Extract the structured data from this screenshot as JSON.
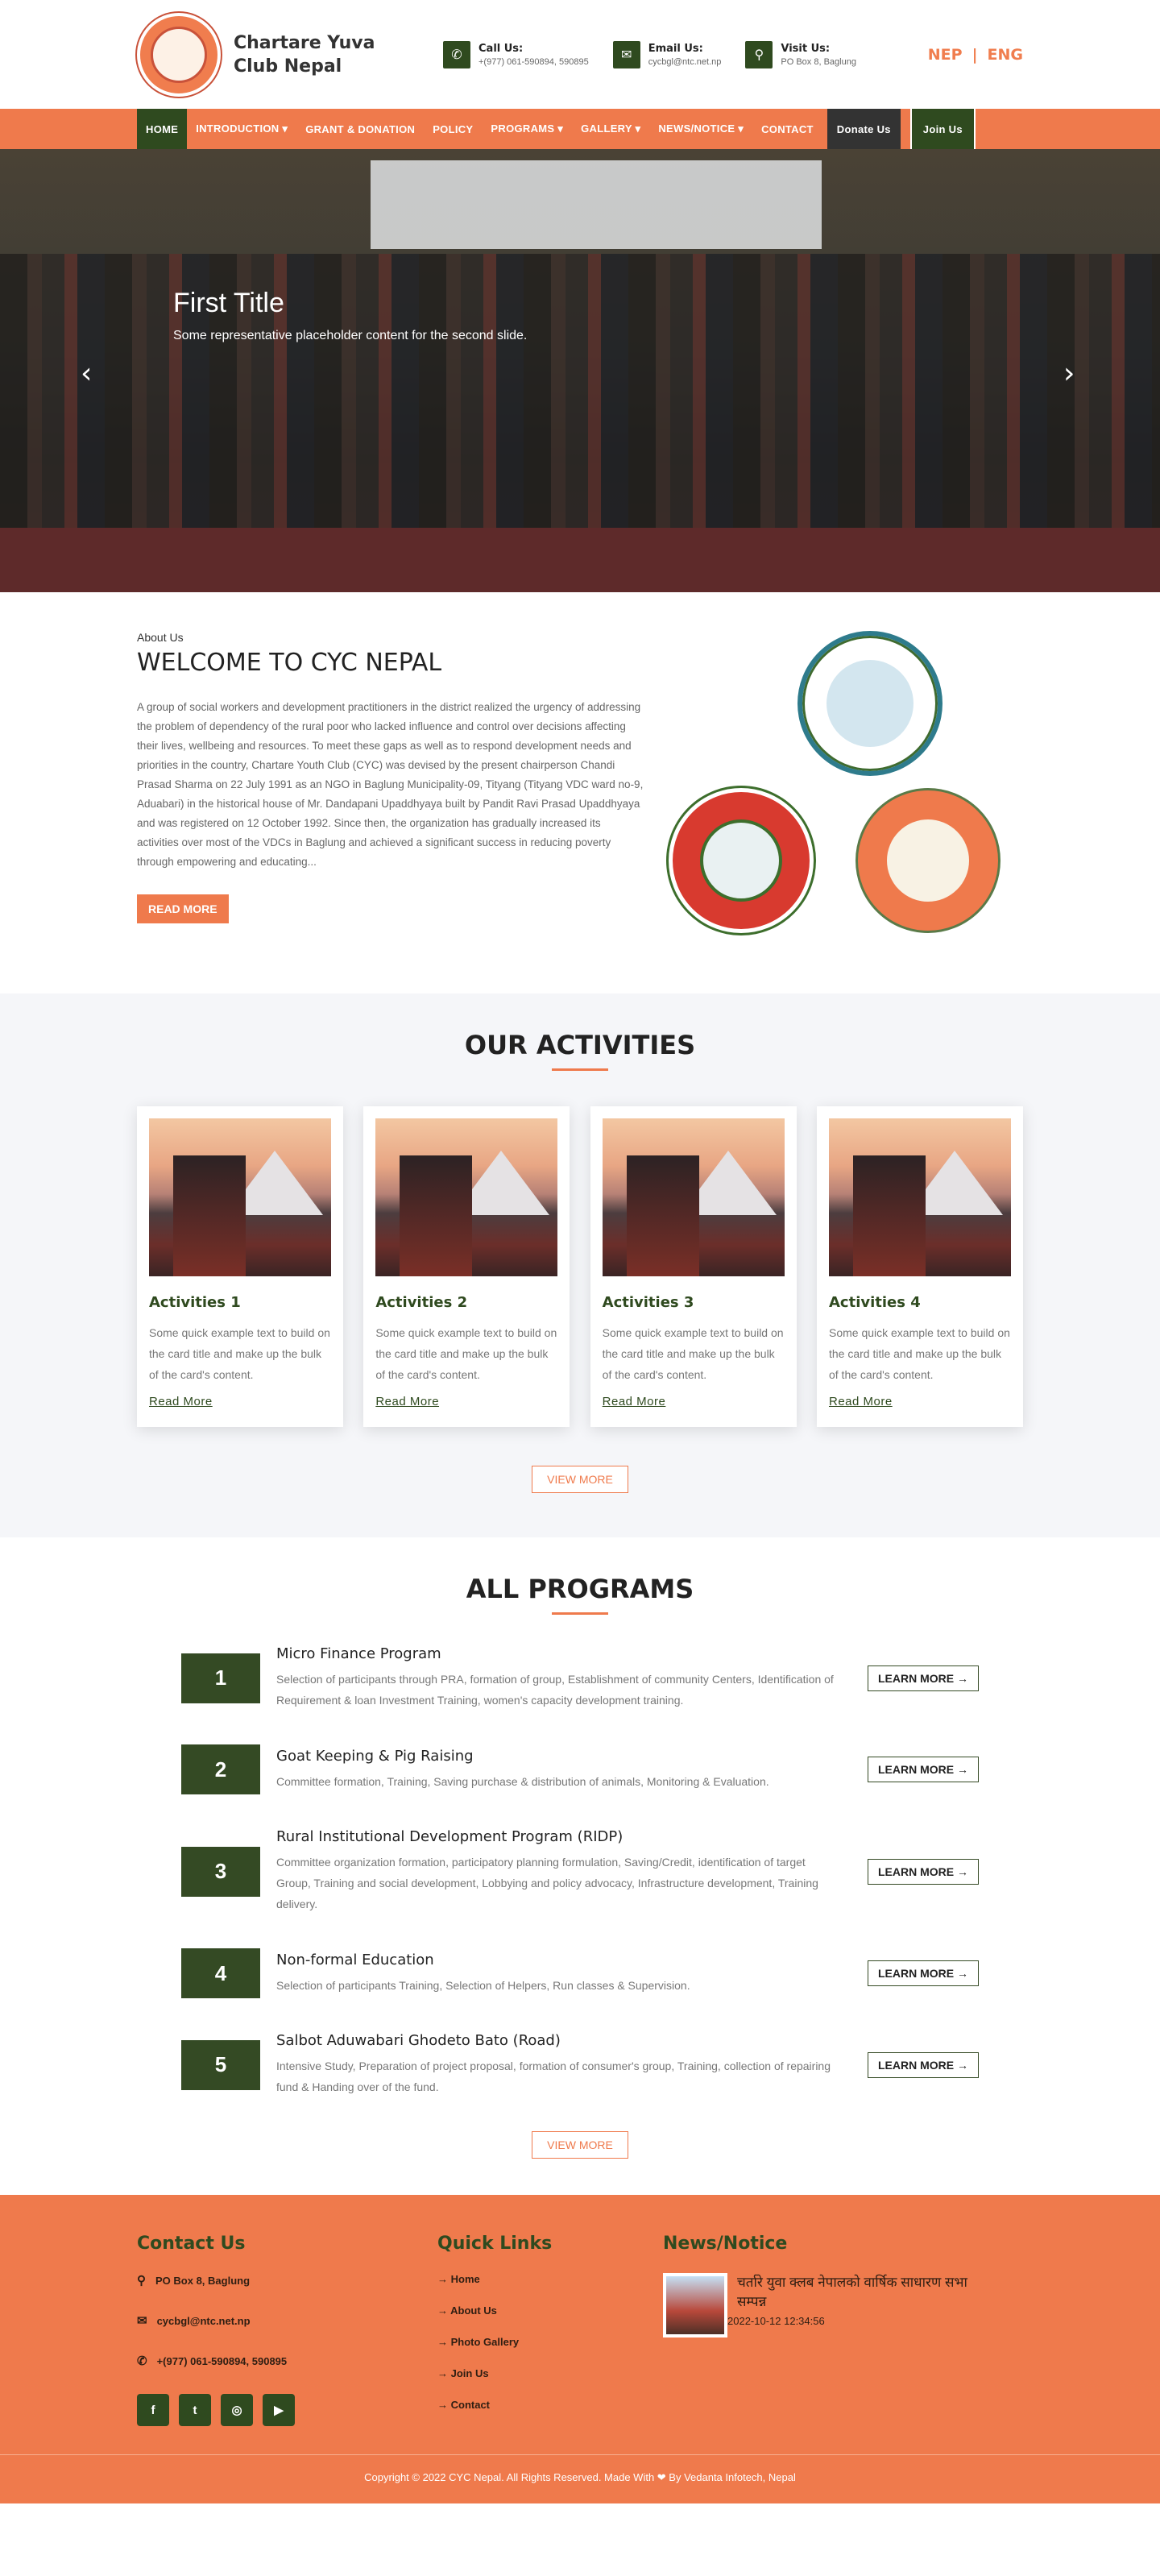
{
  "header": {
    "brand_line1": "Chartare Yuva",
    "brand_line2": "Club Nepal",
    "call_label": "Call Us:",
    "call_value": "+(977) 061-590894, 590895",
    "email_label": "Email Us:",
    "email_value": "cycbgl@ntc.net.np",
    "visit_label": "Visit Us:",
    "visit_value": "PO Box 8, Baglung",
    "lang_nep": "NEP",
    "lang_sep": "|",
    "lang_eng": "ENG"
  },
  "nav": {
    "home": "HOME",
    "introduction": "INTRODUCTION ▾",
    "grant": "GRANT & DONATION",
    "policy": "POLICY",
    "programs": "PROGRAMS ▾",
    "gallery": "GALLERY ▾",
    "news": "NEWS/NOTICE ▾",
    "contact": "CONTACT",
    "donate": "Donate Us",
    "join": "Join Us"
  },
  "hero": {
    "title": "First Title",
    "text": "Some representative placeholder content for the second slide.",
    "prev": "‹",
    "next": "›"
  },
  "about": {
    "sub": "About Us",
    "title": "WELCOME TO CYC NEPAL",
    "body": "A group of social workers and development practitioners in the district realized the urgency of addressing the problem of dependency of the rural poor who lacked influence and control over decisions affecting their lives, wellbeing and resources. To meet these gaps as well as to respond development needs and priorities in the country, Chartare Youth Club (CYC) was devised by the present chairperson Chandi Prasad Sharma on 22 July 1991 as an NGO in Baglung Municipality-09, Tityang (Tityang VDC ward no-9, Aduabari) in the historical house of Mr. Dandapani Upaddhyaya built by Pandit Ravi Prasad Upaddhyaya and was registered on 12 October 1992. Since then, the organization has gradually increased its activities over most of the VDCs in Baglung and achieved a significant success in reducing poverty through empowering and educating...",
    "button": "READ MORE"
  },
  "activities": {
    "title": "OUR ACTIVITIES",
    "items": [
      {
        "title": "Activities 1",
        "text": "Some quick example text to build on the card title and make up the bulk of the card's content.",
        "link": "Read More"
      },
      {
        "title": "Activities 2",
        "text": "Some quick example text to build on the card title and make up the bulk of the card's content.",
        "link": "Read More"
      },
      {
        "title": "Activities 3",
        "text": "Some quick example text to build on the card title and make up the bulk of the card's content.",
        "link": "Read More"
      },
      {
        "title": "Activities 4",
        "text": "Some quick example text to build on the card title and make up the bulk of the card's content.",
        "link": "Read More"
      }
    ],
    "view_more": "VIEW MORE"
  },
  "programs": {
    "title": "ALL PROGRAMS",
    "items": [
      {
        "num": "1",
        "title": "Micro Finance Program",
        "text": "Selection of participants through PRA, formation of group, Establishment of community Centers, Identification of Requirement & loan Investment Training, women's capacity development training.",
        "button": "LEARN MORE →"
      },
      {
        "num": "2",
        "title": "Goat Keeping & Pig Raising",
        "text": "Committee formation, Training, Saving purchase & distribution of animals, Monitoring & Evaluation.",
        "button": "LEARN MORE →"
      },
      {
        "num": "3",
        "title": "Rural Institutional Development Program (RIDP)",
        "text": "Committee organization formation, participatory planning formulation, Saving/Credit, identification of target Group, Training and social development, Lobbying and policy advocacy, Infrastructure development, Training delivery.",
        "button": "LEARN MORE →"
      },
      {
        "num": "4",
        "title": "Non-formal Education",
        "text": "Selection of participants Training, Selection of Helpers, Run classes & Supervision.",
        "button": "LEARN MORE →"
      },
      {
        "num": "5",
        "title": "Salbot Aduwabari Ghodeto Bato (Road)",
        "text": "Intensive Study, Preparation of project proposal, formation of consumer's group, Training, collection of repairing fund & Handing over of the fund.",
        "button": "LEARN MORE →"
      }
    ],
    "view_more": "VIEW MORE"
  },
  "footer": {
    "contact_title": "Contact Us",
    "address": "PO Box 8, Baglung",
    "email": "cycbgl@ntc.net.np",
    "phone": "+(977) 061-590894, 590895",
    "social": [
      "f",
      "t",
      "◎",
      "▶"
    ],
    "links_title": "Quick Links",
    "links": [
      "→ Home",
      "→ About Us",
      "→ Photo Gallery",
      "→ Join Us",
      "→ Contact"
    ],
    "news_title": "News/Notice",
    "news_item_title": "चर्तारे युवा क्लब नेपालको वार्षिक साधारण सभा सम्पन्न",
    "news_item_date": "2022-10-12 12:34:56"
  },
  "copyright": "Copyright © 2022 CYC Nepal. All Rights Reserved. Made With ❤ By Vedanta Infotech, Nepal",
  "colors": {
    "accent": "#ef7a4c",
    "dark_green": "#2f4a1f"
  }
}
